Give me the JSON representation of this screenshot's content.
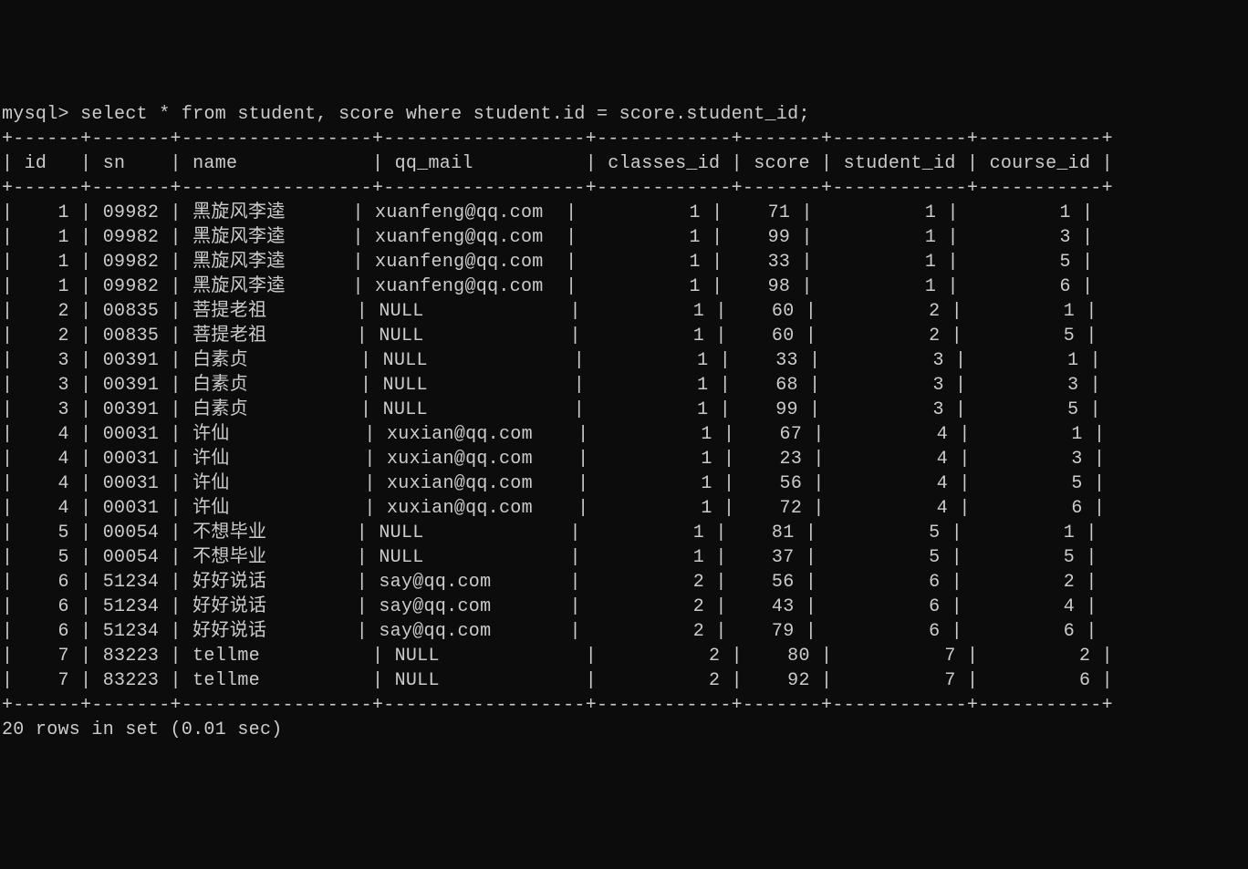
{
  "prompt_prefix": "mysql> ",
  "query": "select * from student, score where student.id = score.student_id;",
  "border_top": "+------+-------+-----------------+------------------+------------+-------+------------+-----------+",
  "header_line": "| id   | sn    | name            | qq_mail          | classes_id | score | student_id | course_id |",
  "border_mid": "+------+-------+-----------------+------------------+------------+-------+------------+-----------+",
  "rows": [
    "|    1 | 09982 | 黑旋风李逵      | xuanfeng@qq.com  |          1 |    71 |          1 |         1 |",
    "|    1 | 09982 | 黑旋风李逵      | xuanfeng@qq.com  |          1 |    99 |          1 |         3 |",
    "|    1 | 09982 | 黑旋风李逵      | xuanfeng@qq.com  |          1 |    33 |          1 |         5 |",
    "|    1 | 09982 | 黑旋风李逵      | xuanfeng@qq.com  |          1 |    98 |          1 |         6 |",
    "|    2 | 00835 | 菩提老祖        | NULL             |          1 |    60 |          2 |         1 |",
    "|    2 | 00835 | 菩提老祖        | NULL             |          1 |    60 |          2 |         5 |",
    "|    3 | 00391 | 白素贞          | NULL             |          1 |    33 |          3 |         1 |",
    "|    3 | 00391 | 白素贞          | NULL             |          1 |    68 |          3 |         3 |",
    "|    3 | 00391 | 白素贞          | NULL             |          1 |    99 |          3 |         5 |",
    "|    4 | 00031 | 许仙            | xuxian@qq.com    |          1 |    67 |          4 |         1 |",
    "|    4 | 00031 | 许仙            | xuxian@qq.com    |          1 |    23 |          4 |         3 |",
    "|    4 | 00031 | 许仙            | xuxian@qq.com    |          1 |    56 |          4 |         5 |",
    "|    4 | 00031 | 许仙            | xuxian@qq.com    |          1 |    72 |          4 |         6 |",
    "|    5 | 00054 | 不想毕业        | NULL             |          1 |    81 |          5 |         1 |",
    "|    5 | 00054 | 不想毕业        | NULL             |          1 |    37 |          5 |         5 |",
    "|    6 | 51234 | 好好说话        | say@qq.com       |          2 |    56 |          6 |         2 |",
    "|    6 | 51234 | 好好说话        | say@qq.com       |          2 |    43 |          6 |         4 |",
    "|    6 | 51234 | 好好说话        | say@qq.com       |          2 |    79 |          6 |         6 |",
    "|    7 | 83223 | tellme          | NULL             |          2 |    80 |          7 |         2 |",
    "|    7 | 83223 | tellme          | NULL             |          2 |    92 |          7 |         6 |"
  ],
  "border_bottom": "+------+-------+-----------------+------------------+------------+-------+------------+-----------+",
  "footer": "20 rows in set (0.01 sec)",
  "columns": [
    "id",
    "sn",
    "name",
    "qq_mail",
    "classes_id",
    "score",
    "student_id",
    "course_id"
  ],
  "data": [
    {
      "id": 1,
      "sn": "09982",
      "name": "黑旋风李逵",
      "qq_mail": "xuanfeng@qq.com",
      "classes_id": 1,
      "score": 71,
      "student_id": 1,
      "course_id": 1
    },
    {
      "id": 1,
      "sn": "09982",
      "name": "黑旋风李逵",
      "qq_mail": "xuanfeng@qq.com",
      "classes_id": 1,
      "score": 99,
      "student_id": 1,
      "course_id": 3
    },
    {
      "id": 1,
      "sn": "09982",
      "name": "黑旋风李逵",
      "qq_mail": "xuanfeng@qq.com",
      "classes_id": 1,
      "score": 33,
      "student_id": 1,
      "course_id": 5
    },
    {
      "id": 1,
      "sn": "09982",
      "name": "黑旋风李逵",
      "qq_mail": "xuanfeng@qq.com",
      "classes_id": 1,
      "score": 98,
      "student_id": 1,
      "course_id": 6
    },
    {
      "id": 2,
      "sn": "00835",
      "name": "菩提老祖",
      "qq_mail": "NULL",
      "classes_id": 1,
      "score": 60,
      "student_id": 2,
      "course_id": 1
    },
    {
      "id": 2,
      "sn": "00835",
      "name": "菩提老祖",
      "qq_mail": "NULL",
      "classes_id": 1,
      "score": 60,
      "student_id": 2,
      "course_id": 5
    },
    {
      "id": 3,
      "sn": "00391",
      "name": "白素贞",
      "qq_mail": "NULL",
      "classes_id": 1,
      "score": 33,
      "student_id": 3,
      "course_id": 1
    },
    {
      "id": 3,
      "sn": "00391",
      "name": "白素贞",
      "qq_mail": "NULL",
      "classes_id": 1,
      "score": 68,
      "student_id": 3,
      "course_id": 3
    },
    {
      "id": 3,
      "sn": "00391",
      "name": "白素贞",
      "qq_mail": "NULL",
      "classes_id": 1,
      "score": 99,
      "student_id": 3,
      "course_id": 5
    },
    {
      "id": 4,
      "sn": "00031",
      "name": "许仙",
      "qq_mail": "xuxian@qq.com",
      "classes_id": 1,
      "score": 67,
      "student_id": 4,
      "course_id": 1
    },
    {
      "id": 4,
      "sn": "00031",
      "name": "许仙",
      "qq_mail": "xuxian@qq.com",
      "classes_id": 1,
      "score": 23,
      "student_id": 4,
      "course_id": 3
    },
    {
      "id": 4,
      "sn": "00031",
      "name": "许仙",
      "qq_mail": "xuxian@qq.com",
      "classes_id": 1,
      "score": 56,
      "student_id": 4,
      "course_id": 5
    },
    {
      "id": 4,
      "sn": "00031",
      "name": "许仙",
      "qq_mail": "xuxian@qq.com",
      "classes_id": 1,
      "score": 72,
      "student_id": 4,
      "course_id": 6
    },
    {
      "id": 5,
      "sn": "00054",
      "name": "不想毕业",
      "qq_mail": "NULL",
      "classes_id": 1,
      "score": 81,
      "student_id": 5,
      "course_id": 1
    },
    {
      "id": 5,
      "sn": "00054",
      "name": "不想毕业",
      "qq_mail": "NULL",
      "classes_id": 1,
      "score": 37,
      "student_id": 5,
      "course_id": 5
    },
    {
      "id": 6,
      "sn": "51234",
      "name": "好好说话",
      "qq_mail": "say@qq.com",
      "classes_id": 2,
      "score": 56,
      "student_id": 6,
      "course_id": 2
    },
    {
      "id": 6,
      "sn": "51234",
      "name": "好好说话",
      "qq_mail": "say@qq.com",
      "classes_id": 2,
      "score": 43,
      "student_id": 6,
      "course_id": 4
    },
    {
      "id": 6,
      "sn": "51234",
      "name": "好好说话",
      "qq_mail": "say@qq.com",
      "classes_id": 2,
      "score": 79,
      "student_id": 6,
      "course_id": 6
    },
    {
      "id": 7,
      "sn": "83223",
      "name": "tellme",
      "qq_mail": "NULL",
      "classes_id": 2,
      "score": 80,
      "student_id": 7,
      "course_id": 2
    },
    {
      "id": 7,
      "sn": "83223",
      "name": "tellme",
      "qq_mail": "NULL",
      "classes_id": 2,
      "score": 92,
      "student_id": 7,
      "course_id": 6
    }
  ]
}
